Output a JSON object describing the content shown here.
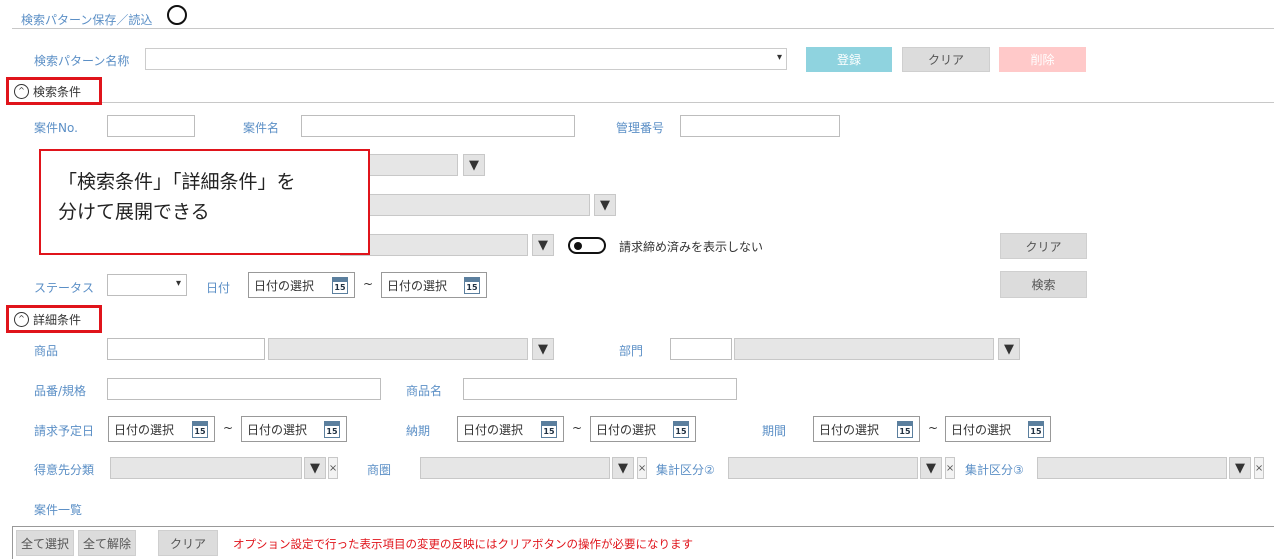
{
  "header": {
    "title": "検索パターン保存／読込",
    "help_icon": "?"
  },
  "pattern": {
    "label": "検索パターン名称",
    "register": "登録",
    "clear": "クリア",
    "delete": "削除"
  },
  "search_section": {
    "title": "検索条件",
    "case_no": "案件No.",
    "case_name": "案件名",
    "mgmt_no": "管理番号",
    "hide_closed": "請求締め済みを表示しない",
    "clear": "クリア",
    "status": "ステータス",
    "date": "日付",
    "date_placeholder": "日付の選択",
    "tilde": "~",
    "search": "検索"
  },
  "callout": {
    "line1": "「検索条件」「詳細条件」を",
    "line2": "分けて展開できる"
  },
  "detail_section": {
    "title": "詳細条件",
    "product": "商品",
    "department": "部門",
    "part_no": "品番/規格",
    "product_name": "商品名",
    "billing_date": "請求予定日",
    "delivery": "納期",
    "period": "期間",
    "customer_class": "得意先分類",
    "trade_area": "商圏",
    "agg2": "集計区分②",
    "agg3": "集計区分③"
  },
  "list": {
    "title": "案件一覧",
    "select_all": "全て選択",
    "deselect_all": "全て解除",
    "clear": "クリア",
    "note": "オプション設定で行った表示項目の変更の反映にはクリアボタンの操作が必要になります"
  },
  "icons": {
    "triangle": "▼",
    "small_triangle": "▾",
    "close": "×",
    "up": "^",
    "cal_day": "15"
  },
  "colors": {
    "label_blue": "#5b8fc6",
    "register_btn": "#8fd3df",
    "delete_btn": "#ffc9c9",
    "highlight_red": "#e0141b",
    "note_red": "#e0141b"
  }
}
